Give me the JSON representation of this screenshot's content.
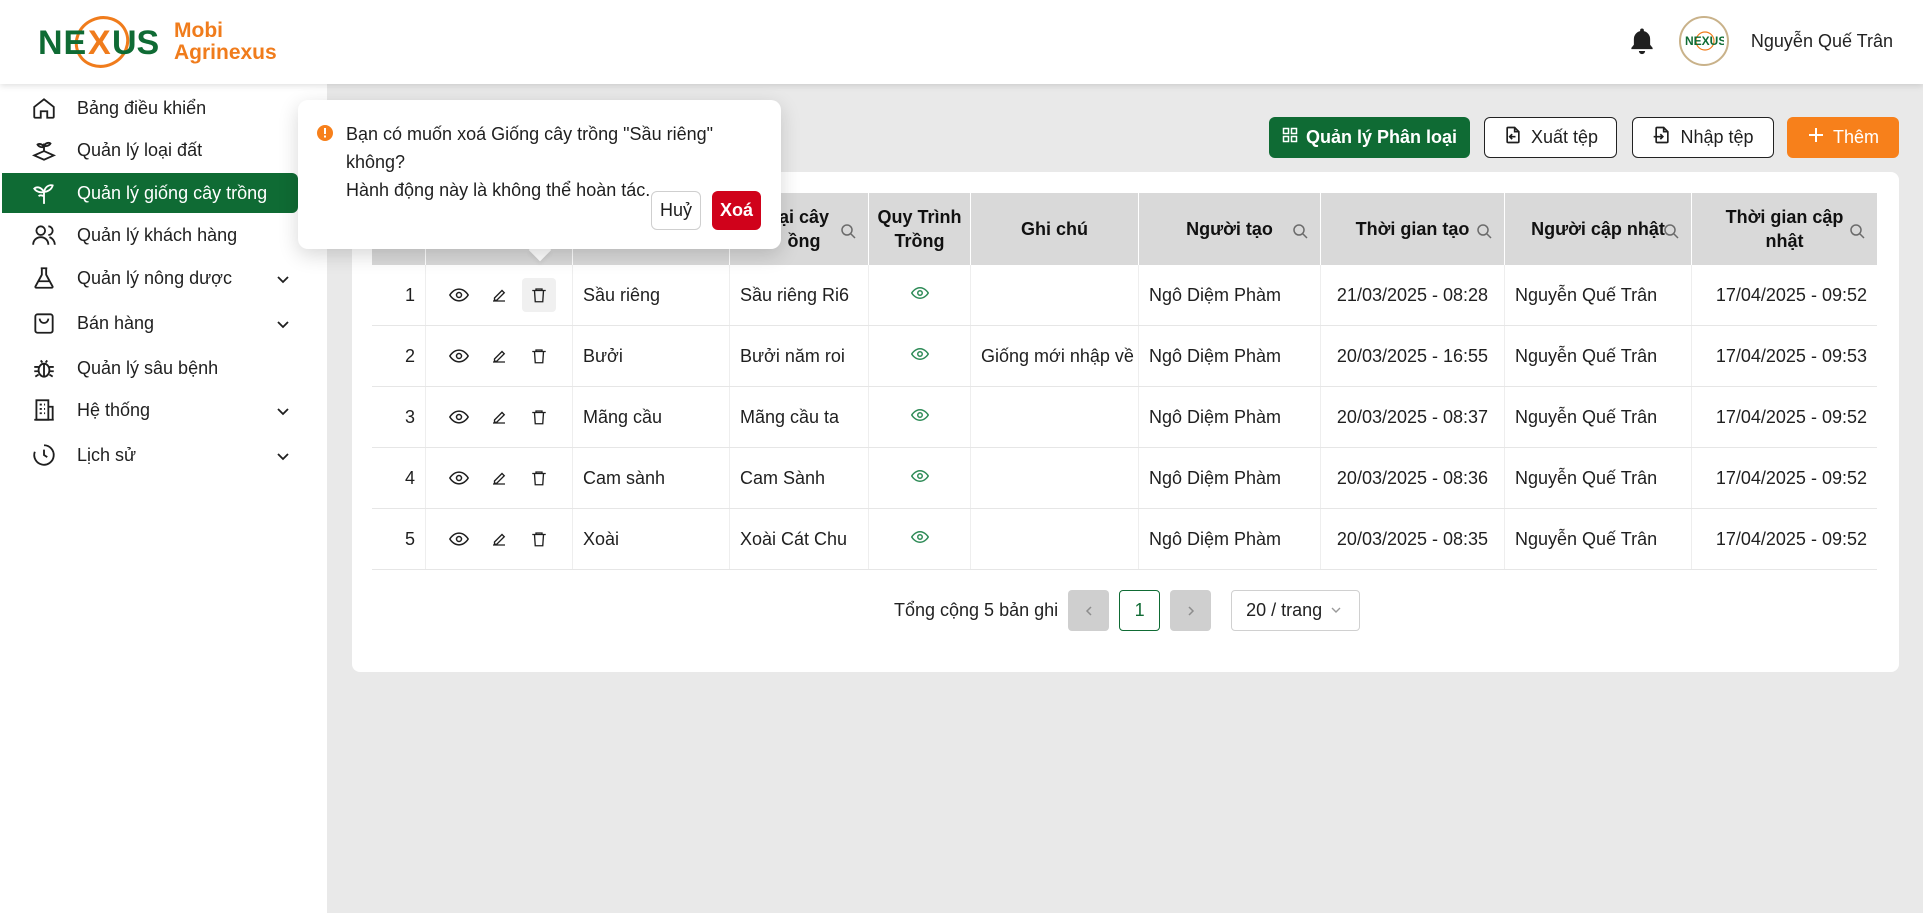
{
  "app": {
    "logo_line1": "Mobi",
    "logo_line2": "Agrinexus",
    "logo_wordmark": "NEXUS",
    "colors": {
      "brand_green": "#0f6b34",
      "brand_orange": "#f07c1c",
      "danger": "#d0021b"
    }
  },
  "header": {
    "user_name": "Nguyễn Quế Trân",
    "notification_icon": "bell-icon"
  },
  "sidebar": {
    "items": [
      {
        "label": "Bảng điều khiển",
        "icon": "home-icon"
      },
      {
        "label": "Quản lý loại đất",
        "icon": "soil-icon"
      },
      {
        "label": "Quản lý giống cây trồng",
        "icon": "plant-icon",
        "active": true
      },
      {
        "label": "Quản lý khách hàng",
        "icon": "users-icon"
      },
      {
        "label": "Quản lý nông dược",
        "icon": "flask-icon"
      },
      {
        "label": "Bán hàng",
        "icon": "bag-icon"
      },
      {
        "label": "Quản lý sâu bệnh",
        "icon": "bug-icon"
      },
      {
        "label": "Hệ thống",
        "icon": "building-icon"
      },
      {
        "label": "Lịch sử",
        "icon": "history-icon"
      }
    ]
  },
  "toolbar": {
    "category_label": "Quản lý Phân loại",
    "export_label": "Xuất tệp",
    "import_label": "Nhập tệp",
    "add_label": "Thêm"
  },
  "table": {
    "headers": {
      "variety_partial_line1": "ại cây",
      "variety_partial_line2": "ồng",
      "process_line1": "Quy Trình",
      "process_line2": "Trồng",
      "note": "Ghi chú",
      "creator": "Người tạo",
      "created_at": "Thời gian tạo",
      "updater": "Người cập nhật",
      "updated_at_line1": "Thời gian cập",
      "updated_at_line2": "nhật"
    },
    "rows": [
      {
        "no": "1",
        "name": "Sầu riêng",
        "variety": "Sầu riêng Ri6",
        "note": "",
        "creator": "Ngô Diệm Phàm",
        "created_at": "21/03/2025 - 08:28",
        "updater": "Nguyễn Quế Trân",
        "updated_at": "17/04/2025 - 09:52"
      },
      {
        "no": "2",
        "name": "Bưởi",
        "variety": "Bưởi năm roi",
        "note": "Giống mới nhập về",
        "creator": "Ngô Diệm Phàm",
        "created_at": "20/03/2025 - 16:55",
        "updater": "Nguyễn Quế Trân",
        "updated_at": "17/04/2025 - 09:53"
      },
      {
        "no": "3",
        "name": "Mãng cầu",
        "variety": "Mãng cầu ta",
        "note": "",
        "creator": "Ngô Diệm Phàm",
        "created_at": "20/03/2025 - 08:37",
        "updater": "Nguyễn Quế Trân",
        "updated_at": "17/04/2025 - 09:52"
      },
      {
        "no": "4",
        "name": "Cam sành",
        "variety": "Cam Sành",
        "note": "",
        "creator": "Ngô Diệm Phàm",
        "created_at": "20/03/2025 - 08:36",
        "updater": "Nguyễn Quế Trân",
        "updated_at": "17/04/2025 - 09:52"
      },
      {
        "no": "5",
        "name": "Xoài",
        "variety": "Xoài Cát Chu",
        "note": "",
        "creator": "Ngô Diệm Phàm",
        "created_at": "20/03/2025 - 08:35",
        "updater": "Nguyễn Quế Trân",
        "updated_at": "17/04/2025 - 09:52"
      }
    ]
  },
  "pagination": {
    "total_text": "Tổng cộng 5 bản ghi",
    "current_page": "1",
    "page_size": "20 / trang"
  },
  "popconfirm": {
    "line1": "Bạn có muốn xoá Giống cây trồng \"Sầu riêng\" không?",
    "line2": "Hành động này là không thể hoàn tác.",
    "cancel_label": "Huỷ",
    "ok_label": "Xoá"
  }
}
